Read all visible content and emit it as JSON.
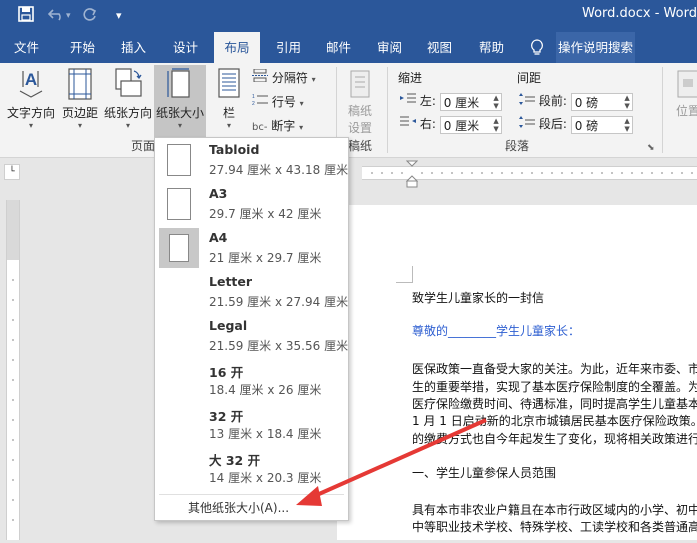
{
  "titlebar": {
    "title": "Word.docx  -  Word",
    "quick_access": [
      "save-icon",
      "undo-icon",
      "redo-icon",
      "customize-icon"
    ]
  },
  "menu": {
    "tabs": [
      {
        "label": "文件"
      },
      {
        "label": "开始"
      },
      {
        "label": "插入"
      },
      {
        "label": "设计"
      },
      {
        "label": "布局"
      },
      {
        "label": "引用"
      },
      {
        "label": "邮件"
      },
      {
        "label": "审阅"
      },
      {
        "label": "视图"
      },
      {
        "label": "帮助"
      }
    ],
    "active_tab": "布局",
    "tell_me": "操作说明搜索"
  },
  "ribbon": {
    "page_setup": {
      "text_direction": "文字方向",
      "margins": "页边距",
      "orientation": "纸张方向",
      "size": "纸张大小",
      "columns": "栏",
      "breaks": "分隔符",
      "line_numbers": "行号",
      "hyphenation": "断字",
      "group_label": "页面"
    },
    "draft": {
      "label1": "稿纸",
      "label2": "设置",
      "group_label": "稿纸"
    },
    "paragraph": {
      "indent_header": "缩进",
      "spacing_header": "间距",
      "left_label": "左:",
      "left_value": "0 厘米",
      "right_label": "右:",
      "right_value": "0 厘米",
      "before_label": "段前:",
      "before_value": "0 磅",
      "after_label": "段后:",
      "after_value": "0 磅",
      "group_label": "段落"
    },
    "position_label": "位置"
  },
  "dropdown": {
    "items": [
      {
        "name": "Tabloid",
        "size": "27.94 厘米 x 43.18 厘米",
        "selected": false
      },
      {
        "name": "A3",
        "size": "29.7 厘米 x 42 厘米",
        "selected": false
      },
      {
        "name": "A4",
        "size": "21 厘米 x 29.7 厘米",
        "selected": true
      },
      {
        "name": "Letter",
        "size": "21.59 厘米 x 27.94 厘米",
        "selected": false
      },
      {
        "name": "Legal",
        "size": "21.59 厘米 x 35.56 厘米",
        "selected": false
      },
      {
        "name": "16 开",
        "size": "18.4 厘米 x 26 厘米",
        "selected": false
      },
      {
        "name": "32 开",
        "size": "13 厘米 x 18.4 厘米",
        "selected": false
      },
      {
        "name": "大 32 开",
        "size": "14 厘米 x 20.3 厘米",
        "selected": false
      }
    ],
    "more": "其他纸张大小(A)..."
  },
  "document": {
    "lines": [
      "致学生儿童家长的一封信",
      "尊敬的________学生儿童家长：",
      "医保政策一直备受大家的关注。为此，近年来市委、市",
      "生的重要举措，实现了基本医疗保险制度的全覆盖。为",
      "医疗保险缴费时间、待遇标准，同时提高学生儿童基本",
      "1 月 1 日启动新的北京市城镇居民基本医疗保险政策。",
      "的缴费方式也自今年起发生了变化，现将相关政策进行",
      "一、学生儿童参保人员范围",
      "具有本市非农业户籍且在本市行政区域内的小学、初中",
      "中等职业技术学校、特殊学校、工读学校和各类普通高"
    ]
  },
  "colors": {
    "brand": "#2b579a",
    "greeting": "#2e5fd1",
    "annotation_arrow": "#e53935"
  }
}
